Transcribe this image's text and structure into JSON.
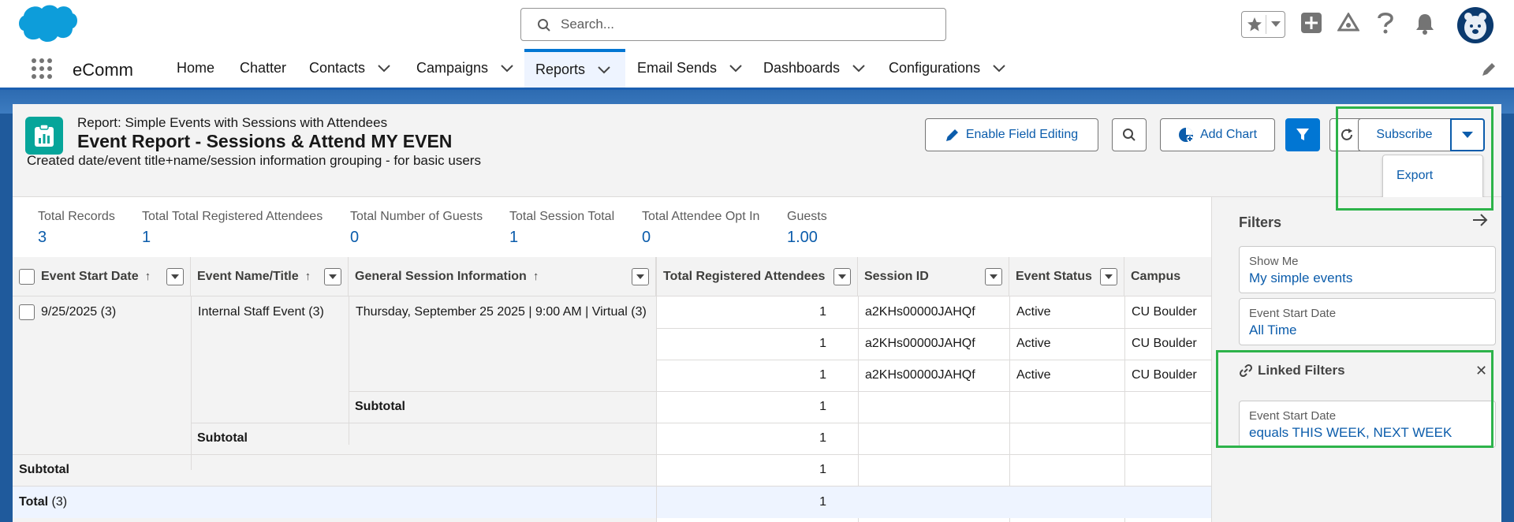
{
  "header": {
    "search_placeholder": "Search..."
  },
  "nav": {
    "app_name": "eComm",
    "items": [
      {
        "label": "Home"
      },
      {
        "label": "Chatter"
      },
      {
        "label": "Contacts"
      },
      {
        "label": "Campaigns"
      },
      {
        "label": "Reports"
      },
      {
        "label": "Email Sends"
      },
      {
        "label": "Dashboards"
      },
      {
        "label": "Configurations"
      }
    ]
  },
  "report": {
    "subtitle": "Report: Simple Events with Sessions with Attendees",
    "title": "Event Report - Sessions & Attend MY EVEN",
    "description": "Created date/event title+name/session information grouping - for basic users",
    "actions": {
      "enable_editing": "Enable Field Editing",
      "add_chart": "Add Chart",
      "subscribe": "Subscribe",
      "export": "Export"
    }
  },
  "summary": [
    {
      "label": "Total Records",
      "value": "3"
    },
    {
      "label": "Total Total Registered Attendees",
      "value": "1"
    },
    {
      "label": "Total Number of Guests",
      "value": "0"
    },
    {
      "label": "Total Session Total",
      "value": "1"
    },
    {
      "label": "Total Attendee Opt In",
      "value": "0"
    },
    {
      "label": "Guests",
      "value": "1.00"
    }
  ],
  "table": {
    "columns": [
      "Event Start Date",
      "Event Name/Title",
      "General Session Information",
      "Total Registered Attendees",
      "Session ID",
      "Event Status",
      "Campus"
    ],
    "group1": "9/25/2025 (3)",
    "group2": "Internal Staff Event (3)",
    "group3": "Thursday, September 25 2025 | 9:00 AM | Virtual (3)",
    "rows": [
      {
        "total": "1",
        "session_id": "a2KHs00000JAHQf",
        "status": "Active",
        "campus": "CU Boulder"
      },
      {
        "total": "1",
        "session_id": "a2KHs00000JAHQf",
        "status": "Active",
        "campus": "CU Boulder"
      },
      {
        "total": "1",
        "session_id": "a2KHs00000JAHQf",
        "status": "Active",
        "campus": "CU Boulder"
      }
    ],
    "subtotal_label": "Subtotal",
    "subtotal1": "1",
    "subtotal2": "1",
    "subtotal3": "1",
    "total_label": "Total",
    "total_count": "(3)",
    "total_value": "1"
  },
  "filters": {
    "title": "Filters",
    "show_me_label": "Show Me",
    "show_me_value": "My simple events",
    "start_date_label": "Event Start Date",
    "start_date_value": "All Time",
    "linked_title": "Linked Filters",
    "linked_label": "Event Start Date",
    "linked_value": "equals THIS WEEK, NEXT WEEK"
  },
  "colors": {
    "brand": "#0176d3",
    "link": "#0b5cab",
    "highlight": "#2db34a",
    "report_icon": "#06a59a"
  }
}
